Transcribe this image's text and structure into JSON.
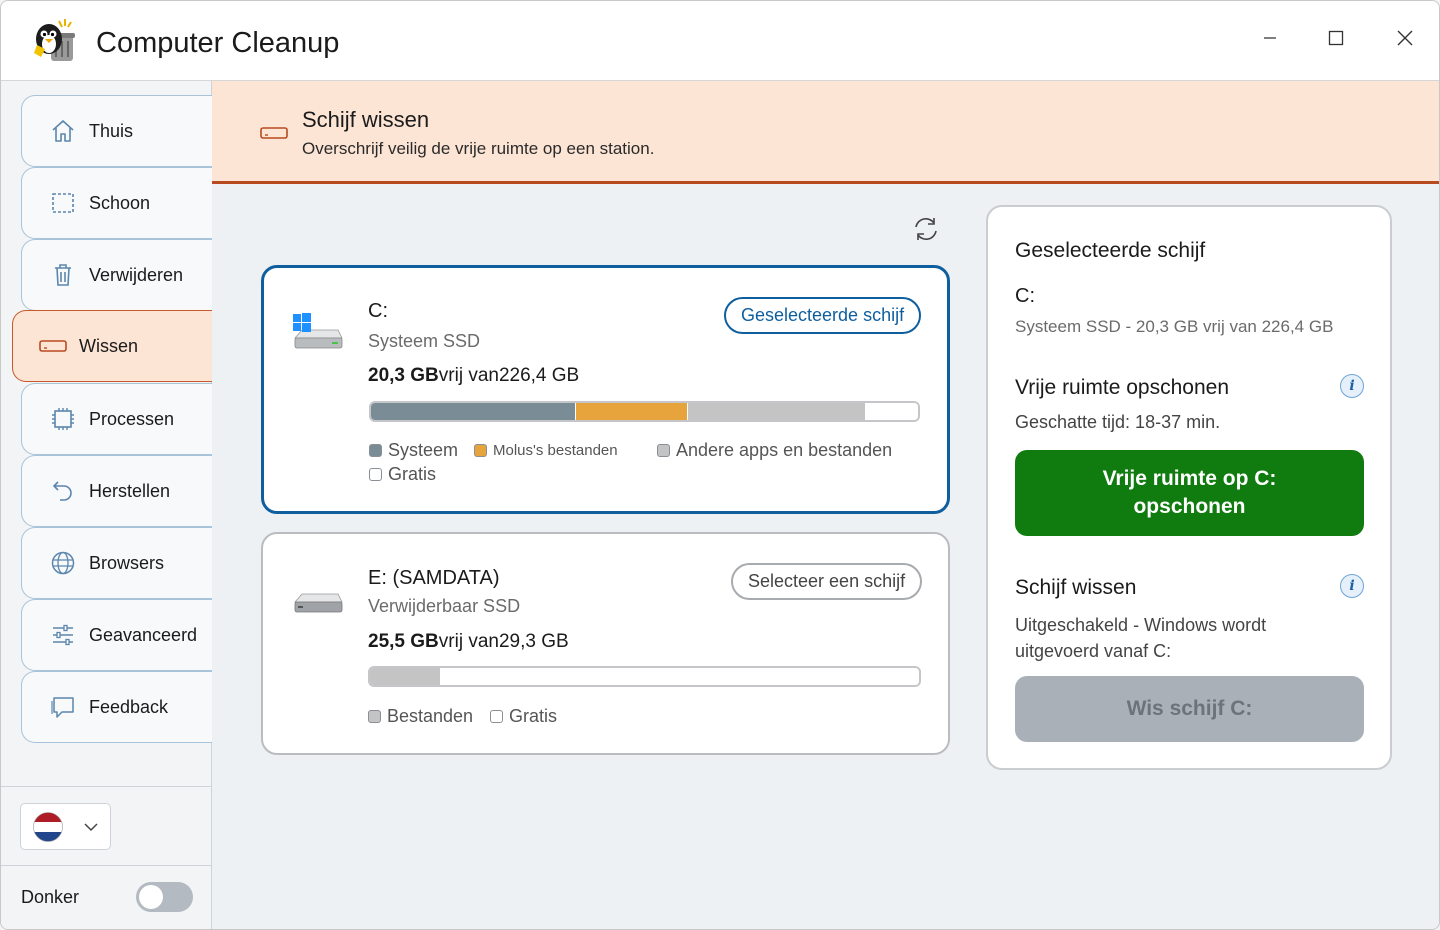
{
  "app": {
    "title": "Computer Cleanup",
    "window_controls": [
      "minimize-icon",
      "maximize-icon",
      "close-icon"
    ]
  },
  "sidebar": {
    "items": [
      {
        "label": "Thuis",
        "icon": "home-icon",
        "active": false
      },
      {
        "label": "Schoon",
        "icon": "clean-icon",
        "active": false
      },
      {
        "label": "Verwijderen",
        "icon": "trash-icon",
        "active": false
      },
      {
        "label": "Wissen",
        "icon": "drive-icon",
        "active": true
      },
      {
        "label": "Processen",
        "icon": "processor-icon",
        "active": false
      },
      {
        "label": "Herstellen",
        "icon": "restore-icon",
        "active": false
      },
      {
        "label": "Browsers",
        "icon": "globe-icon",
        "active": false
      },
      {
        "label": "Geavanceerd",
        "icon": "sliders-icon",
        "active": false
      },
      {
        "label": "Feedback",
        "icon": "feedback-icon",
        "active": false
      }
    ],
    "language_flag": "netherlands-flag-icon",
    "dark_label": "Donker",
    "dark_enabled": false
  },
  "banner": {
    "title": "Schijf wissen",
    "subtitle": "Overschrijf veilig de vrije ruimte op een station."
  },
  "drives": [
    {
      "name": "C:",
      "type": "Systeem SSD",
      "free": "20,3 GB",
      "free_mid": "vrij van",
      "total": "226,4 GB",
      "button": "Geselecteerde schijf",
      "selected": true,
      "segments": [
        {
          "label": "Systeem",
          "fraction": 0.375,
          "color": "#7a8c96"
        },
        {
          "label": "Molus's bestanden",
          "fraction": 0.205,
          "color": "#e8a43c"
        },
        {
          "label": "Andere apps en bestanden",
          "fraction": 0.325,
          "color": "#c4c4c4"
        },
        {
          "label": "Gratis",
          "fraction": 0.095,
          "color": "#ffffff"
        }
      ]
    },
    {
      "name": "E: (SAMDATA)",
      "type": "Verwijderbaar SSD",
      "free": "25,5 GB",
      "free_mid": "vrij van",
      "total": "29,3 GB",
      "button": "Selecteer een schijf",
      "selected": false,
      "segments": [
        {
          "label": "Bestanden",
          "fraction": 0.13,
          "color": "#c4c4c4"
        },
        {
          "label": "Gratis",
          "fraction": 0.87,
          "color": "#ffffff"
        }
      ]
    }
  ],
  "panel": {
    "title": "Geselecteerde schijf",
    "drive": "C:",
    "drive_detail": "Systeem SSD - 20,3 GB vrij van 226,4 GB",
    "cleanup_title": "Vrije ruimte opschonen",
    "estimate": "Geschatte tijd: 18-37 min.",
    "cleanup_button": "Vrije ruimte op C: opschonen",
    "wipe_title": "Schijf wissen",
    "wipe_status": "Uitgeschakeld - Windows wordt uitgevoerd vanaf C:",
    "wipe_button": "Wis schijf C:",
    "info_glyph": "i"
  },
  "colors": {
    "accent": "#0f5f9e",
    "active_nav": "#fde5d5",
    "banner_border": "#b84a1f",
    "green": "#107c10"
  }
}
